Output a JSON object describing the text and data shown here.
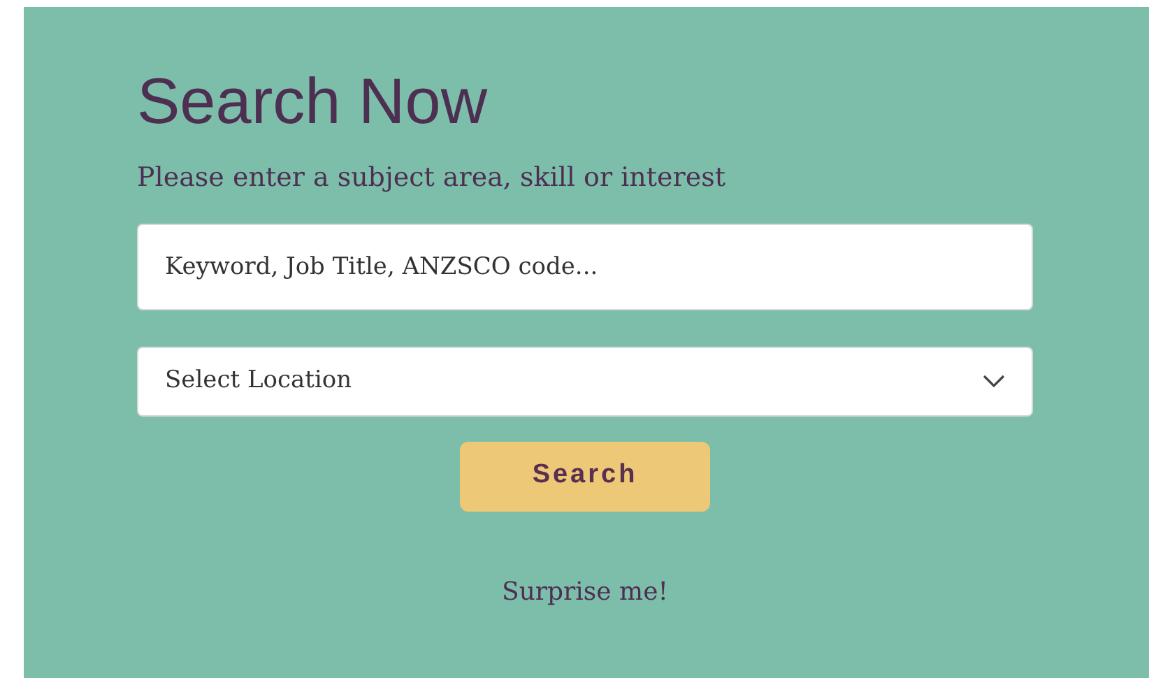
{
  "title": "Search Now",
  "subtitle": "Please enter a subject area, skill or interest",
  "keyword_field": {
    "placeholder": "Keyword, Job Title, ANZSCO code..."
  },
  "location_select": {
    "value": "Select Location"
  },
  "search_button": "Search",
  "surprise_link": "Surprise me!"
}
